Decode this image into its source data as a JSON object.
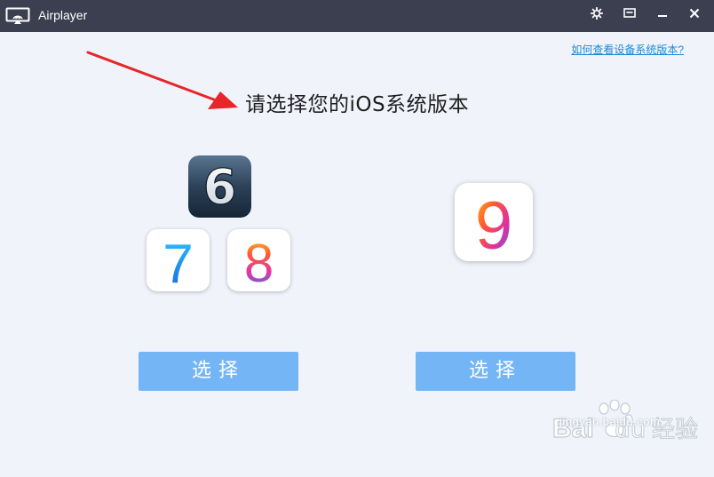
{
  "window": {
    "title": "Airplayer",
    "icon": "airplay-monitor-icon",
    "controls": [
      "settings-icon",
      "minimize-to-tray-icon",
      "minimize-icon",
      "close-icon"
    ]
  },
  "help_link": "如何查看设备系统版本?",
  "heading": "请选择您的iOS系统版本",
  "options": [
    {
      "icons": [
        {
          "glyph": "6",
          "name": "ios6-icon"
        },
        {
          "glyph": "7",
          "name": "ios7-icon"
        },
        {
          "glyph": "8",
          "name": "ios8-icon"
        }
      ],
      "button": "选择"
    },
    {
      "icons": [
        {
          "glyph": "9",
          "name": "ios9-icon"
        }
      ],
      "button": "选择"
    }
  ],
  "watermark": {
    "brand_left": "Bai",
    "brand_right": "经验",
    "url": "jingyan.baidu.com"
  },
  "colors": {
    "titlebar": "#3b3f50",
    "background": "#f0f3fa",
    "button": "#74b6f5",
    "link": "#1b8ad6",
    "annotation_arrow": "#e8262a"
  }
}
